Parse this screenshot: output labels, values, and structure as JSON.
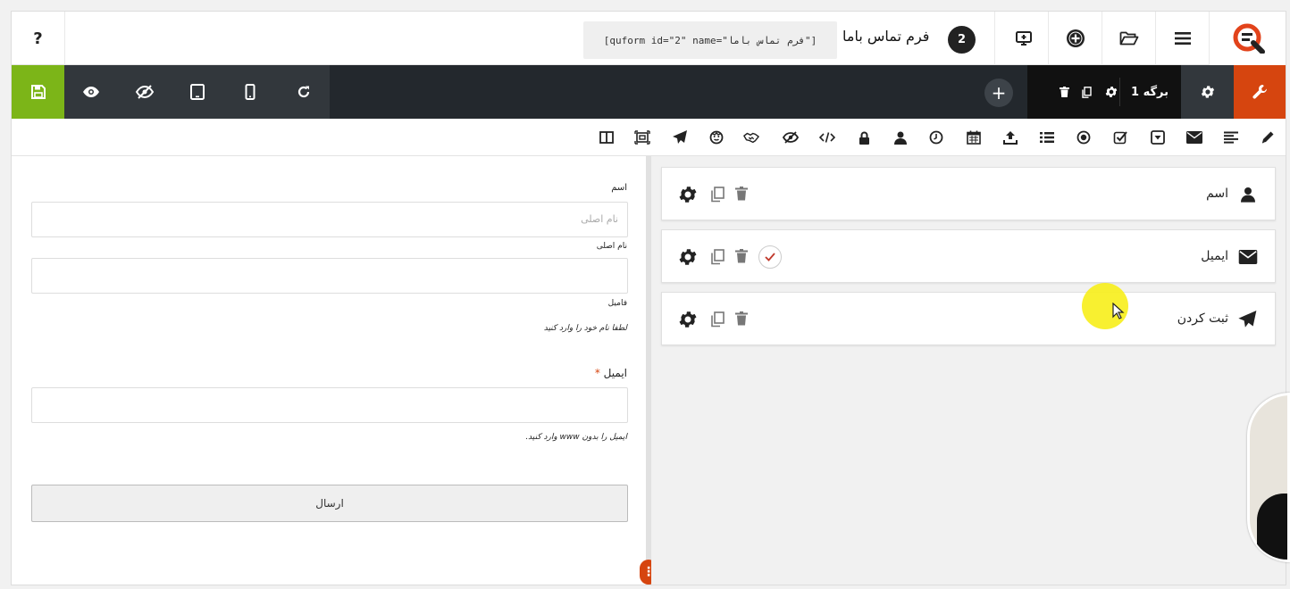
{
  "header": {
    "help_label": "?",
    "shortcode": "[quform id=\"2\" name=\"فرم تماس باما\"]",
    "form_title": "فرم تماس باما",
    "form_id": "2",
    "icons": [
      "help-icon",
      "preview-screen-icon",
      "add-circle-icon",
      "folder-open-icon",
      "menu-icon",
      "quform-logo-icon"
    ]
  },
  "toolbar": {
    "page_label": "برگه 1",
    "add_page": "+",
    "colors": {
      "save": "#7cb518",
      "dark": "#23282d",
      "group": "#32373c",
      "accent": "#d6450f"
    }
  },
  "elements_bar": {
    "icons": [
      "columns-icon",
      "group-icon",
      "submit-icon",
      "captcha-icon",
      "recaptcha-icon",
      "hidden-icon",
      "html-icon",
      "password-icon",
      "name-icon",
      "time-icon",
      "date-icon",
      "file-upload-icon",
      "multi-select-icon",
      "radio-icon",
      "checkbox-icon",
      "select-icon",
      "email-icon",
      "textarea-icon",
      "text-icon"
    ]
  },
  "preview": {
    "name_label": "اسم",
    "first_placeholder": "نام اصلی",
    "first_sublabel": "نام اصلی",
    "last_sublabel": "فامیل",
    "name_description": "لطفا نام خود را وارد کنید",
    "email_label": "ایمیل",
    "required_mark": "*",
    "email_description": "ایمیل را بدون www وارد کنید.",
    "submit_label": "ارسال"
  },
  "builder": {
    "fields": [
      {
        "label": "اسم",
        "icon": "user-icon"
      },
      {
        "label": "ایمیل",
        "icon": "envelope-icon",
        "required": true
      },
      {
        "label": "ثبت کردن",
        "icon": "paper-plane-icon"
      }
    ]
  }
}
